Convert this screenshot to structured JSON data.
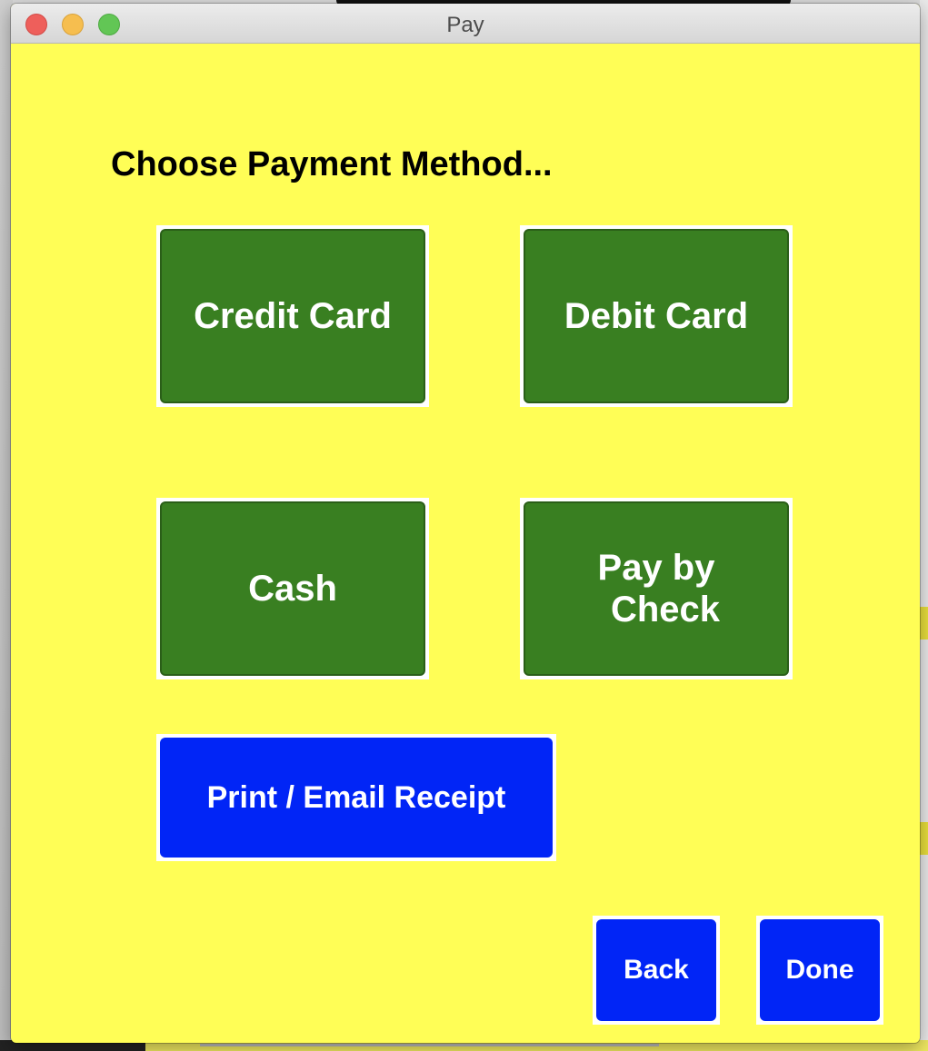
{
  "window": {
    "title": "Pay"
  },
  "heading": "Choose Payment Method...",
  "payment_methods": {
    "credit_card": "Credit Card",
    "debit_card": "Debit Card",
    "cash": "Cash",
    "check_line1": "Pay by",
    "check_line2": "Check"
  },
  "actions": {
    "receipt": "Print / Email Receipt",
    "back": "Back",
    "done": "Done"
  },
  "colors": {
    "background": "#fffe56",
    "payment_button": "#397f21",
    "action_button": "#0125f6",
    "button_text": "#ffffff"
  }
}
